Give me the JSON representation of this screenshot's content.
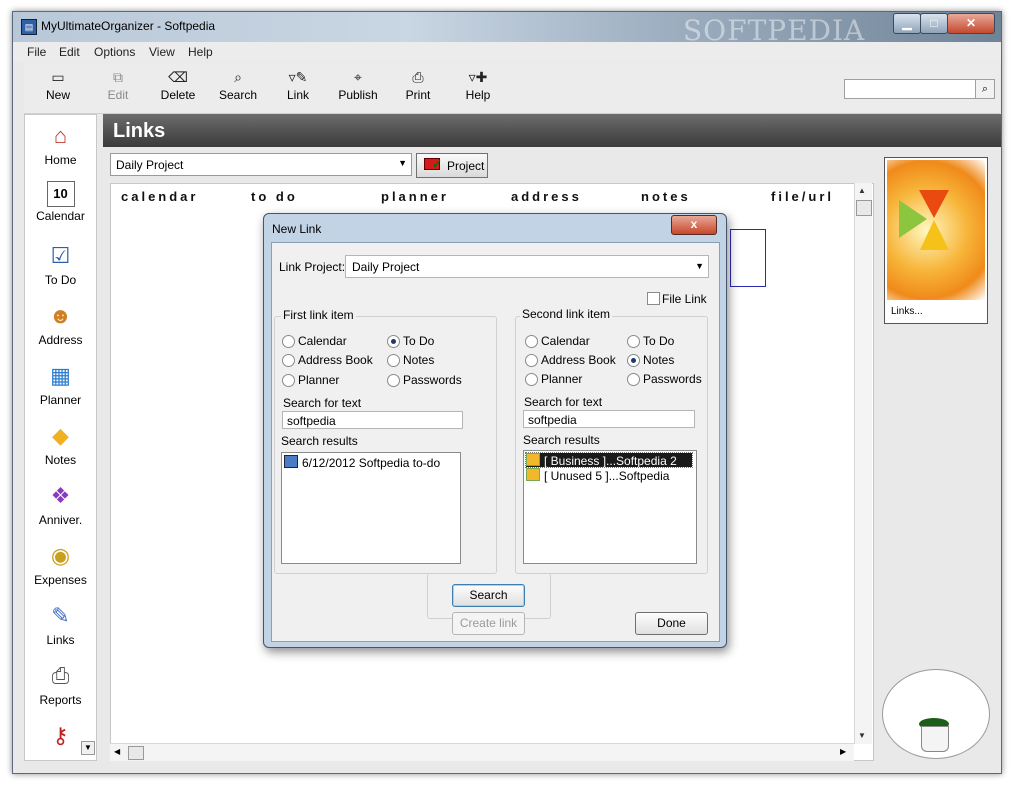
{
  "window": {
    "title": "MyUltimateOrganizer - Softpedia",
    "watermark": "SOFTPEDIA"
  },
  "menu": [
    "File",
    "Edit",
    "Options",
    "View",
    "Help"
  ],
  "toolbar": {
    "new": "New",
    "edit": "Edit",
    "delete": "Delete",
    "search": "Search",
    "link": "Link",
    "publish": "Publish",
    "print": "Print",
    "help": "Help"
  },
  "sidebar": [
    "Home",
    "Calendar",
    "To Do",
    "Address",
    "Planner",
    "Notes",
    "Anniver.",
    "Expenses",
    "Links",
    "Reports"
  ],
  "page": {
    "header": "Links",
    "project_selected": "Daily Project",
    "project_button": "Project",
    "columns": [
      "calendar",
      "to do",
      "planner",
      "address",
      "notes",
      "file/url"
    ],
    "preview_caption": "Links..."
  },
  "dialog": {
    "title": "New Link",
    "close": "x",
    "link_project_label": "Link Project:",
    "link_project_value": "Daily Project",
    "file_link_label": "File Link",
    "first": {
      "title": "First link item",
      "options": [
        "Calendar",
        "To Do",
        "Address Book",
        "Notes",
        "Planner",
        "Passwords"
      ],
      "selected": "To Do",
      "search_label": "Search for text",
      "search_value": "softpedia",
      "results_label": "Search results",
      "results": [
        "6/12/2012 Softpedia to-do"
      ]
    },
    "second": {
      "title": "Second link item",
      "options": [
        "Calendar",
        "To Do",
        "Address Book",
        "Notes",
        "Planner",
        "Passwords"
      ],
      "selected": "Notes",
      "search_label": "Search for text",
      "search_value": "softpedia",
      "results_label": "Search results",
      "results": [
        "[ Business ]...Softpedia 2",
        "[ Unused 5 ]...Softpedia"
      ]
    },
    "search_button": "Search",
    "create_button": "Create link",
    "done_button": "Done"
  }
}
